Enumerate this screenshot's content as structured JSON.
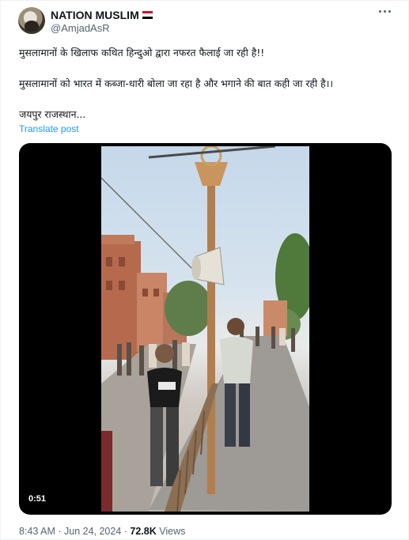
{
  "author": {
    "display_name": "NATION MUSLIM",
    "handle": "@AmjadAsR",
    "flag_icon": "egypt-flag-icon",
    "flag_colors": [
      "#ce1126",
      "#ffffff",
      "#000000"
    ]
  },
  "tweet": {
    "line1": "मुसलामानों के खिलाफ कथित हिन्दुओ द्वारा नफरत फैलाई जा रही है!!",
    "line2": "मुसलामानों को भारत में कब्जा-धारी बोला जा रहा है और भगाने की बात कही जा रही है।।",
    "line3": "जयपुर राजस्थान...",
    "translate_label": "Translate post"
  },
  "video": {
    "duration": "0:51"
  },
  "meta": {
    "time": "8:43 AM",
    "date": "Jun 24, 2024",
    "views_count": "72.8K",
    "views_label": "Views"
  },
  "colors": {
    "text": "#0f1419",
    "secondary": "#536471",
    "link": "#1d9bf0"
  }
}
